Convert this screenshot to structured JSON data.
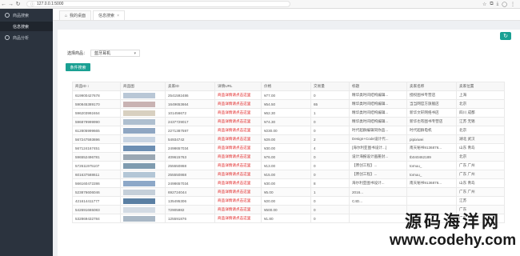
{
  "browser": {
    "url": "127.0.0.1:5000",
    "back_icon": "←",
    "forward_icon": "→",
    "reload_icon": "↻",
    "home_icon": "⌂"
  },
  "sidebar": {
    "items": [
      {
        "label": "商品搜索",
        "icon": "user-icon"
      },
      {
        "label": "信息搜索",
        "icon": ""
      },
      {
        "label": "商品分析",
        "icon": "user-icon"
      }
    ]
  },
  "tabs": [
    {
      "label": "我的桌面",
      "icon": "home-icon"
    },
    {
      "label": "信息搜索",
      "close": "×"
    }
  ],
  "filter": {
    "label": "选择商品：",
    "value": "蓝牙耳机"
  },
  "search_button": "条件搜索",
  "table": {
    "headers": [
      "商品ID ↕",
      "商品图",
      "卖家ID",
      "详情URL",
      "价格",
      "交易量",
      "标题",
      "卖家名称",
      "卖家位置"
    ],
    "rows": [
      [
        "619900427678",
        "",
        "2541592486",
        "商品详情请点击这里",
        "¥77.00",
        "0",
        "精华类时间结构编辑...",
        "授权图书专营店",
        "上海"
      ],
      [
        "590845389170",
        "",
        "1649653664",
        "商品详情请点击这里",
        "¥54.50",
        "65",
        "精华类时间结构编辑...",
        "当当网官方旗舰店",
        "北京"
      ],
      [
        "596203992464",
        "",
        "101456672",
        "商品详情请点击这里",
        "¥62.30",
        "1",
        "精华类时间结构编辑...",
        "新华文轩网络书店",
        "四川 成都"
      ],
      [
        "596879999990",
        "",
        "2437729017",
        "商品详情请点击这里",
        "¥74.30",
        "0",
        "精华类时间结构编辑...",
        "新华也有图书专营店",
        "江苏 无锡"
      ],
      [
        "612805999665",
        "",
        "2271387597",
        "商品详情请点击这里",
        "¥230.00",
        "0",
        "时代超群编辑同你品...",
        "时代超群电机",
        "北京"
      ],
      [
        "567247593696",
        "",
        "54934742",
        "商品详情请点击这里",
        "¥29.00",
        "2",
        "Design+Code设计代...",
        "pipixiwei",
        "湖北 武汉"
      ],
      [
        "567124167451",
        "",
        "2498657034",
        "商品详情请点击这里",
        "¥30.00",
        "4",
        "[海尔利亚图书设计...]",
        "南天秘书9136876...",
        "山东 青岛"
      ],
      [
        "596552496781",
        "",
        "409615763",
        "商品详情请点击这里",
        "¥76.00",
        "0",
        "设计海报设计画册封...",
        "tb040462189",
        "北京"
      ],
      [
        "572611975107",
        "",
        "255550868",
        "商品详情请点击这里",
        "¥13.00",
        "0",
        "【原创工程】...",
        "tomuu_",
        "广东 广州"
      ],
      [
        "601637588611",
        "",
        "255550868",
        "商品详情请点击这里",
        "¥15.00",
        "0",
        "【原创工程】...",
        "tomuu_",
        "广东 广州"
      ],
      [
        "566160472286",
        "",
        "2498657034",
        "商品详情请点击这里",
        "¥30.00",
        "8",
        "海尔利亚图书设计...",
        "南天秘书9136876...",
        "山东 青岛"
      ],
      [
        "523876606046",
        "",
        "692724044",
        "商品详情请点击这里",
        "¥5.00",
        "1",
        "2016...",
        "",
        "广东 广州"
      ],
      [
        "421614411777",
        "",
        "135495306",
        "商品详情请点击这里",
        "¥20.00",
        "0",
        "C4D...",
        "",
        "江苏"
      ],
      [
        "542691665083",
        "",
        "72905982",
        "商品详情请点击这里",
        "¥500.00",
        "0",
        "",
        "",
        "广东"
      ],
      [
        "532869432784",
        "",
        "125591876",
        "商品详情请点击这里",
        "¥1.80",
        "0",
        "",
        "",
        "广东"
      ]
    ]
  },
  "watermark": {
    "line1": "源码海洋网",
    "line2": "www.codehy.com"
  },
  "colors": {
    "accent": "#1aa093",
    "sidebar": "#2b333e",
    "link_red": "#e02222"
  }
}
